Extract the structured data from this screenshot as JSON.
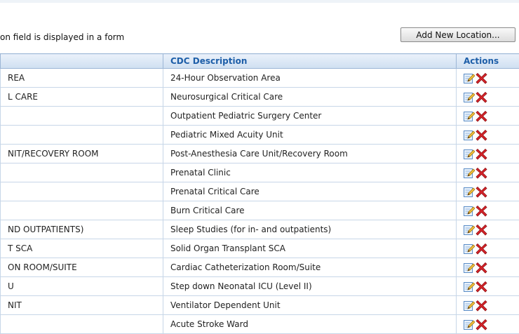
{
  "page": {
    "info_text": "on field is displayed in a form",
    "add_button_label": "Add New Location..."
  },
  "table": {
    "headers": {
      "location": "",
      "cdc": "CDC Description",
      "actions": "Actions"
    },
    "rows": [
      {
        "location": "REA",
        "cdc": "24-Hour Observation Area"
      },
      {
        "location": "L CARE",
        "cdc": "Neurosurgical Critical Care"
      },
      {
        "location": "",
        "cdc": "Outpatient Pediatric Surgery Center"
      },
      {
        "location": "",
        "cdc": "Pediatric Mixed Acuity Unit"
      },
      {
        "location": "NIT/RECOVERY ROOM",
        "cdc": "Post-Anesthesia Care Unit/Recovery Room"
      },
      {
        "location": "",
        "cdc": "Prenatal Clinic"
      },
      {
        "location": "",
        "cdc": "Prenatal Critical Care"
      },
      {
        "location": "",
        "cdc": "Burn Critical Care"
      },
      {
        "location": "ND OUTPATIENTS)",
        "cdc": "Sleep Studies (for in- and outpatients)"
      },
      {
        "location": "T SCA",
        "cdc": "Solid Organ Transplant SCA"
      },
      {
        "location": "ON ROOM/SUITE",
        "cdc": "Cardiac Catheterization Room/Suite"
      },
      {
        "location": "U",
        "cdc": "Step down Neonatal ICU (Level II)"
      },
      {
        "location": "NIT",
        "cdc": "Ventilator Dependent Unit"
      },
      {
        "location": "",
        "cdc": "Acute Stroke Ward"
      }
    ]
  },
  "icons": {
    "edit": "edit-pencil-icon",
    "delete": "delete-x-icon"
  },
  "colors": {
    "header_text": "#1d5ea8",
    "delete": "#d8242a",
    "edit": "#e8b32a"
  }
}
